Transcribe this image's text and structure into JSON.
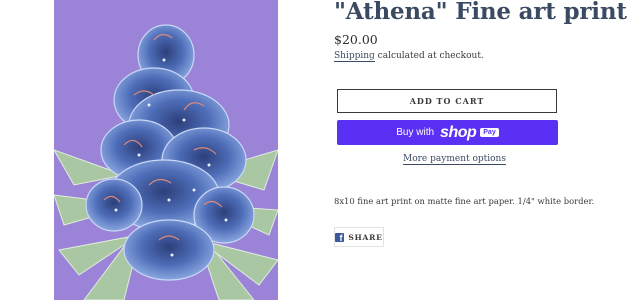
{
  "product": {
    "title": "\"Athena\" Fine art print",
    "price": "$20.00",
    "shipping_link": "Shipping",
    "shipping_text": " calculated at checkout.",
    "description": "8x10 fine art print on matte fine art paper. 1/4\" white border."
  },
  "buttons": {
    "add_to_cart": "ADD TO CART",
    "buy_with": "Buy with",
    "shop_brand": "shop",
    "pay_badge": "Pay",
    "more_payment": "More payment options"
  },
  "social": {
    "share_label": "SHARE",
    "share_icon": "facebook-icon"
  },
  "colors": {
    "accent": "#3b4a63",
    "shop_pay": "#5a31f4",
    "art_background": "#9a82d6"
  }
}
